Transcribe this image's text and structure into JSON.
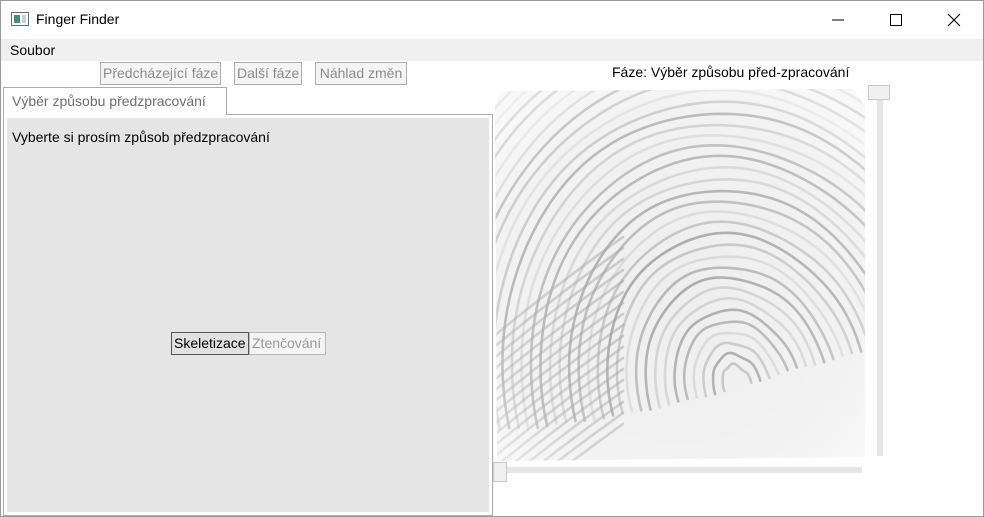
{
  "window": {
    "title": "Finger Finder",
    "icon": "app-icon",
    "controls": [
      "minimize-icon",
      "maximize-icon",
      "close-icon"
    ]
  },
  "menu": {
    "items": [
      {
        "label": "Soubor"
      }
    ]
  },
  "toolbar": {
    "prev_label": "Předcházející fáze",
    "next_label": "Další fáze",
    "preview_label": "Náhlad změn"
  },
  "phase": {
    "text": "Fáze:  Výběr způsobu před-zpracování"
  },
  "tabs": [
    {
      "label": "Výběr způsobu předzpracování",
      "prompt": "Vyberte si prosím způsob předzpracování",
      "options": [
        {
          "label": "Skeletizace"
        },
        {
          "label": "Ztenčování"
        }
      ]
    }
  ],
  "preview": {
    "image": "fingerprint-image",
    "colors": {
      "ridge": "#9a9a9a",
      "background": "#eeeeee"
    }
  }
}
